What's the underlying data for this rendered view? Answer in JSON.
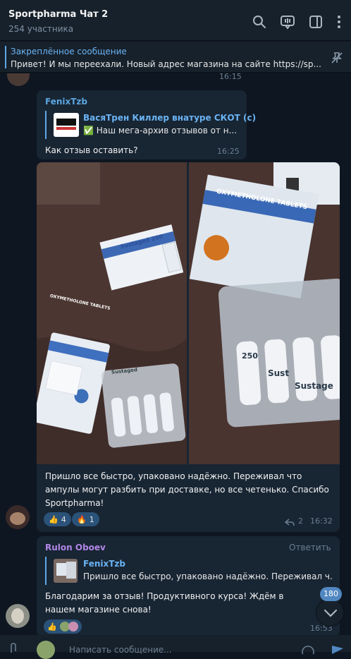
{
  "header": {
    "title": "Sportpharma Чат 2",
    "subtitle": "254 участника"
  },
  "pinned": {
    "title": "Закреплённое сообщение",
    "text": "Привет! И мы переехали. Новый адрес магазина на сайте https://sp..."
  },
  "messages": [
    {
      "time": "16:15"
    },
    {
      "sender": "FenixTzb",
      "reply_title": "ВасяТрен Киллер внатуре СКОТ (с)",
      "reply_text": "✅ Наш мега-архив отзывов от н...",
      "text": "Как отзыв оставить?",
      "time": "16:25"
    },
    {
      "text": "Пришло все быстро, упаковано надёжно. Переживал что ампулы могут разбить при доставке, но все четенько. Спасибо Sportpharma!",
      "reactions": [
        {
          "emoji": "👍",
          "count": "4"
        },
        {
          "emoji": "🔥",
          "count": "1"
        }
      ],
      "replies": "2",
      "time": "16:32",
      "photo_left_labels": [
        "Sustaged 250",
        "OXYMETHOLONE TABLETS",
        "Sustaged"
      ],
      "photo_right_labels": [
        "OXYMETHOLONE TABLETS",
        "250",
        "Sust",
        "Sustage"
      ]
    },
    {
      "sender": "Rulon Oboev",
      "reply_action": "Ответить",
      "reply_title": "FenixTzb",
      "reply_text": "Пришло все быстро, упаковано надёжно. Переживал ч...",
      "text": "Благодарим за отзыв! Продуктивного курса! Ждём в нашем магазине снова!",
      "time": "16:53",
      "reactions": [
        {
          "emoji": "👍"
        }
      ]
    }
  ],
  "composer": {
    "placeholder": "Написать сообщение..."
  },
  "unread_badge": "180",
  "colors": {
    "accent": "#6ab3f3",
    "sender_orange": "#5ba5e0",
    "sender_purple": "#b286e8",
    "bubble": "#182533",
    "background": "#0e1621"
  }
}
